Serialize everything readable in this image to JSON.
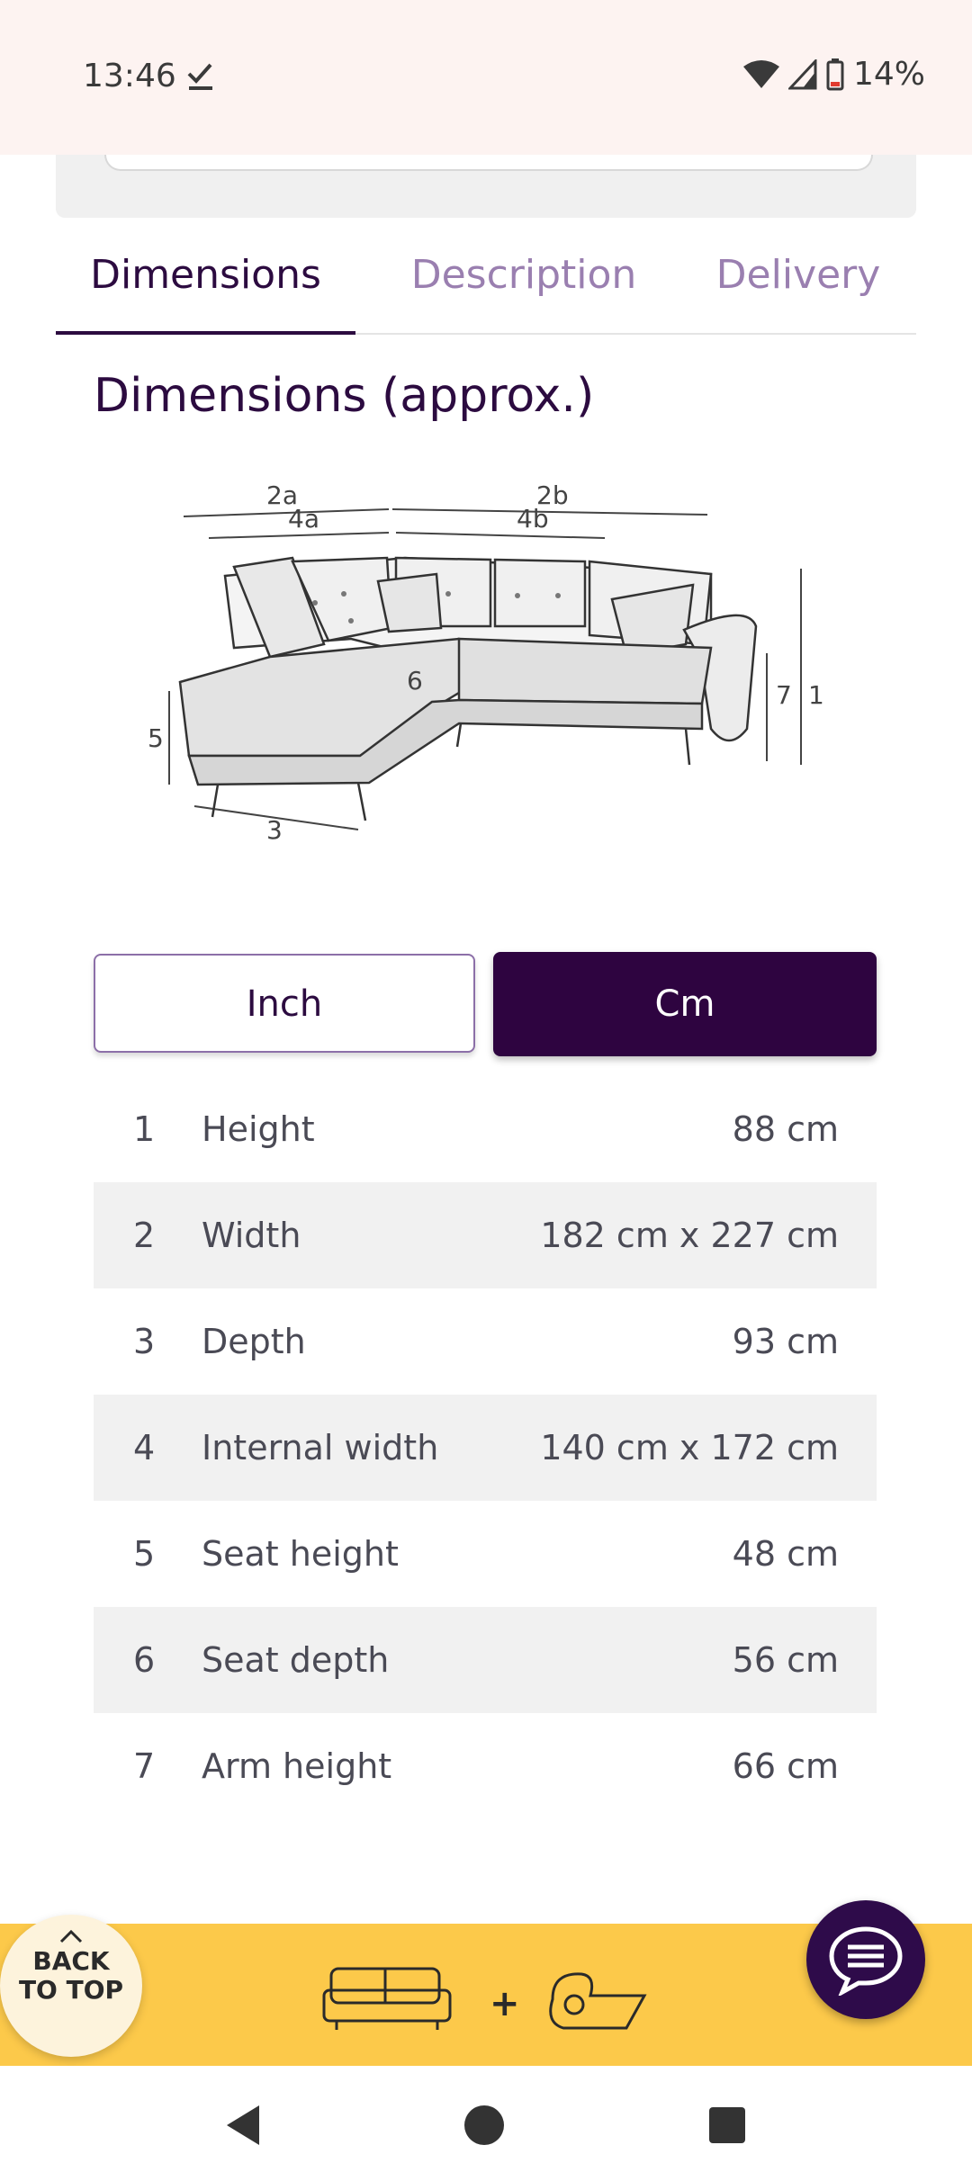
{
  "status_bar": {
    "time": "13:46",
    "battery": "14%"
  },
  "tabs": [
    {
      "label": "Dimensions",
      "active": true
    },
    {
      "label": "Description",
      "active": false
    },
    {
      "label": "Delivery",
      "active": false
    }
  ],
  "section": {
    "title": "Dimensions (approx.)"
  },
  "diagram_labels": {
    "l2a": "2a",
    "l2b": "2b",
    "l4a": "4a",
    "l4b": "4b",
    "l1": "1",
    "l7": "7",
    "l5": "5",
    "l6": "6",
    "l3": "3"
  },
  "units": {
    "inch": "Inch",
    "cm": "Cm",
    "selected": "Cm"
  },
  "dimensions": [
    {
      "num": "1",
      "name": "Height",
      "value": "88 cm"
    },
    {
      "num": "2",
      "name": "Width",
      "value": "182 cm x 227 cm"
    },
    {
      "num": "3",
      "name": "Depth",
      "value": "93 cm"
    },
    {
      "num": "4",
      "name": "Internal width",
      "value": "140 cm x 172 cm"
    },
    {
      "num": "5",
      "name": "Seat height",
      "value": "48 cm"
    },
    {
      "num": "6",
      "name": "Seat depth",
      "value": "56 cm"
    },
    {
      "num": "7",
      "name": "Arm height",
      "value": "66 cm"
    }
  ],
  "back_to_top": {
    "line1": "BACK",
    "line2": "TO TOP"
  },
  "promo": {
    "plus": "+"
  },
  "colors": {
    "accent": "#2e0440",
    "promo": "#fcc94a",
    "tab_inactive": "#9a7fb0"
  }
}
